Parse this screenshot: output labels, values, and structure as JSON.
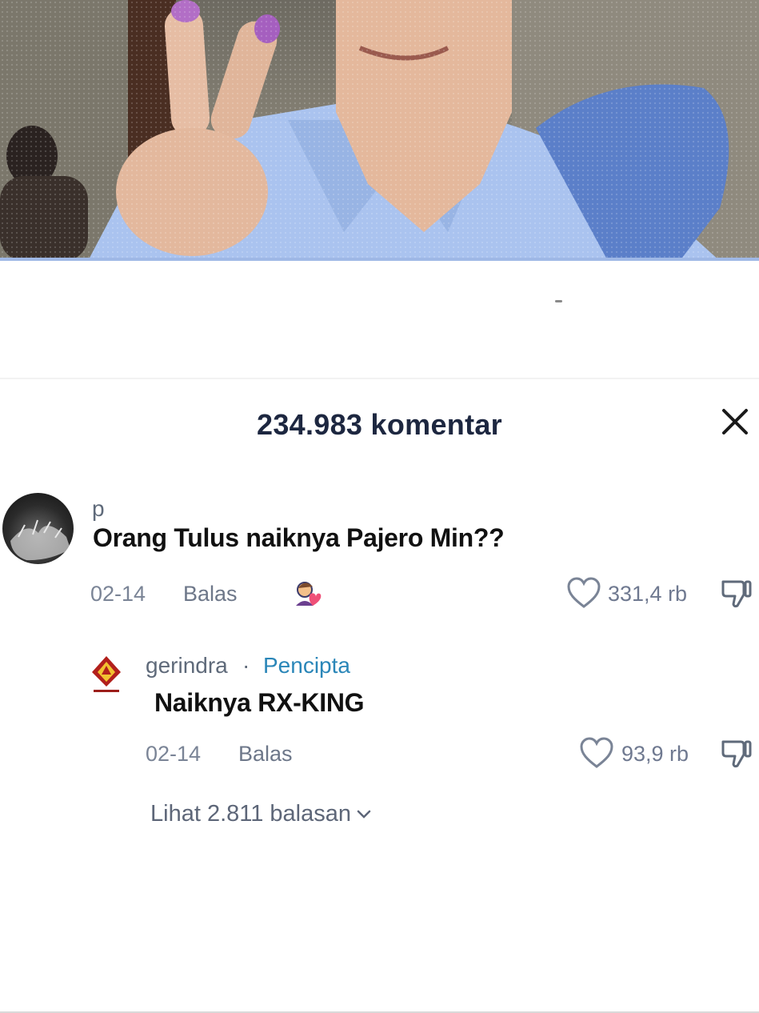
{
  "sheet": {
    "comment_count_label": "234.983 komentar"
  },
  "comments": [
    {
      "username": "p",
      "text": "Orang Tulus naiknya Pajero Min??",
      "date": "02-14",
      "reply_label": "Balas",
      "likes": "331,4 rb",
      "creator_liked": true
    }
  ],
  "reply": {
    "username": "gerindra",
    "separator": "·",
    "badge": "Pencipta",
    "text": "Naiknya RX-KING",
    "date": "02-14",
    "reply_label": "Balas",
    "likes": "93,9 rb"
  },
  "view_replies_label": "Lihat 2.811 balasan",
  "icons": {
    "close": "close-icon",
    "like": "heart-outline-icon",
    "dislike": "thumbs-down-icon",
    "creator_like": "creator-heart-icon",
    "expand": "chevron-down-icon"
  },
  "colors": {
    "creator_badge": "#2a86b8",
    "title": "#1d2740",
    "meta": "#7a8496"
  }
}
